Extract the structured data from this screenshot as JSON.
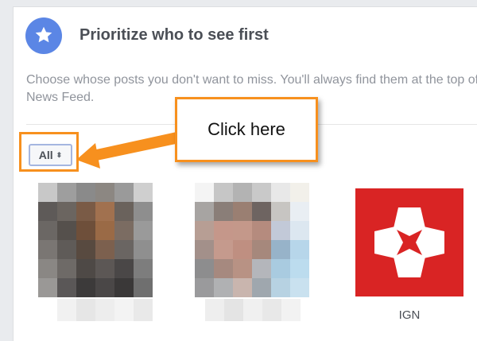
{
  "header": {
    "title": "Prioritize who to see first",
    "description": "Choose whose posts you don't want to miss. You'll always find them at the top of News Feed.",
    "badge_icon": "star-icon"
  },
  "filter": {
    "label": "All",
    "caret": "⬍"
  },
  "annotation": {
    "callout_text": "Click here",
    "accent_color": "#f7901e"
  },
  "profiles": [
    {
      "name": "",
      "obscured": true
    },
    {
      "name": "",
      "obscured": true
    },
    {
      "name": "IGN",
      "obscured": false,
      "tile_color": "#d92424"
    }
  ]
}
